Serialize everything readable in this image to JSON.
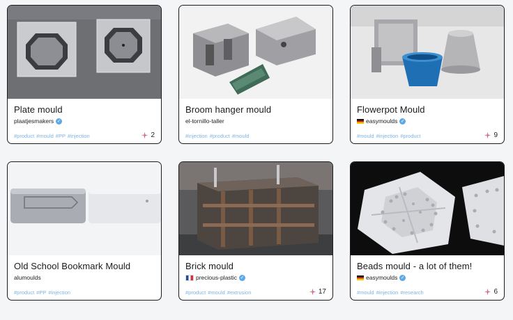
{
  "cards": [
    {
      "title": "Plate mould",
      "author": "plaatjesmakers",
      "flag": "",
      "tags": [
        "#product",
        "#mould",
        "#PP",
        "#injection"
      ],
      "useful": "2"
    },
    {
      "title": "Broom hanger mould",
      "author": "el-tornillo-taller",
      "flag": "",
      "tags": [
        "#injection",
        "#product",
        "#mould"
      ],
      "useful": ""
    },
    {
      "title": "Flowerpot Mould",
      "author": "easymoulds",
      "flag": "de",
      "tags": [
        "#mould",
        "#injection",
        "#product"
      ],
      "useful": "9"
    },
    {
      "title": "Old School Bookmark Mould",
      "author": "alumoulds",
      "flag": "",
      "tags": [
        "#product",
        "#PP",
        "#injection"
      ],
      "useful": ""
    },
    {
      "title": "Brick mould",
      "author": "precious-plastic",
      "flag": "fr",
      "tags": [
        "#product",
        "#mould",
        "#extrusion"
      ],
      "useful": "17"
    },
    {
      "title": "Beads mould - a lot of them!",
      "author": "easymoulds",
      "flag": "de",
      "tags": [
        "#mould",
        "#injection",
        "#research"
      ],
      "useful": "6"
    }
  ],
  "colors": {
    "tag": "#7fb3e3",
    "verified": "#5ea8e6",
    "border": "#1b1b1f"
  },
  "icons": {
    "verified": "verified-check-icon",
    "useful": "useful-star-icon"
  }
}
